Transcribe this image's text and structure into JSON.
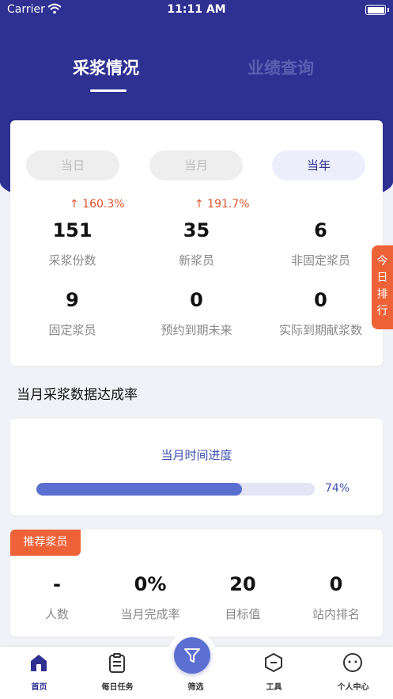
{
  "status": {
    "carrier": "Carrier",
    "time": "11:11 AM"
  },
  "tabs": {
    "active": "采浆情况",
    "inactive": "业绩查询"
  },
  "periods": {
    "day": "当日",
    "month": "当月",
    "year": "当年"
  },
  "stats": {
    "trend1": "↑ 160.3%",
    "trend2": "↑ 191.7%",
    "items": [
      {
        "value": "151",
        "label": "采浆份数"
      },
      {
        "value": "35",
        "label": "新浆员"
      },
      {
        "value": "6",
        "label": "非固定浆员"
      },
      {
        "value": "9",
        "label": "固定浆员"
      },
      {
        "value": "0",
        "label": "预约到期未来"
      },
      {
        "value": "0",
        "label": "实际到期献浆数"
      }
    ]
  },
  "side_tab": "今日排行",
  "section_title": "当月采浆数据达成率",
  "progress": {
    "title": "当月时间进度",
    "percent_text": "74%",
    "fraction": 0.74
  },
  "recommend": {
    "badge": "推荐浆员",
    "items": [
      {
        "value": "-",
        "label": "人数"
      },
      {
        "value": "0%",
        "label": "当月完成率"
      },
      {
        "value": "20",
        "label": "目标值"
      },
      {
        "value": "0",
        "label": "站内排名"
      }
    ]
  },
  "tabbar": {
    "home": "首页",
    "tasks": "每日任务",
    "filter": "筛选",
    "tools": "工具",
    "profile": "个人中心"
  },
  "colors": {
    "primary": "#2e3192",
    "accent": "#ee6237",
    "progress": "#5b6fd0"
  }
}
